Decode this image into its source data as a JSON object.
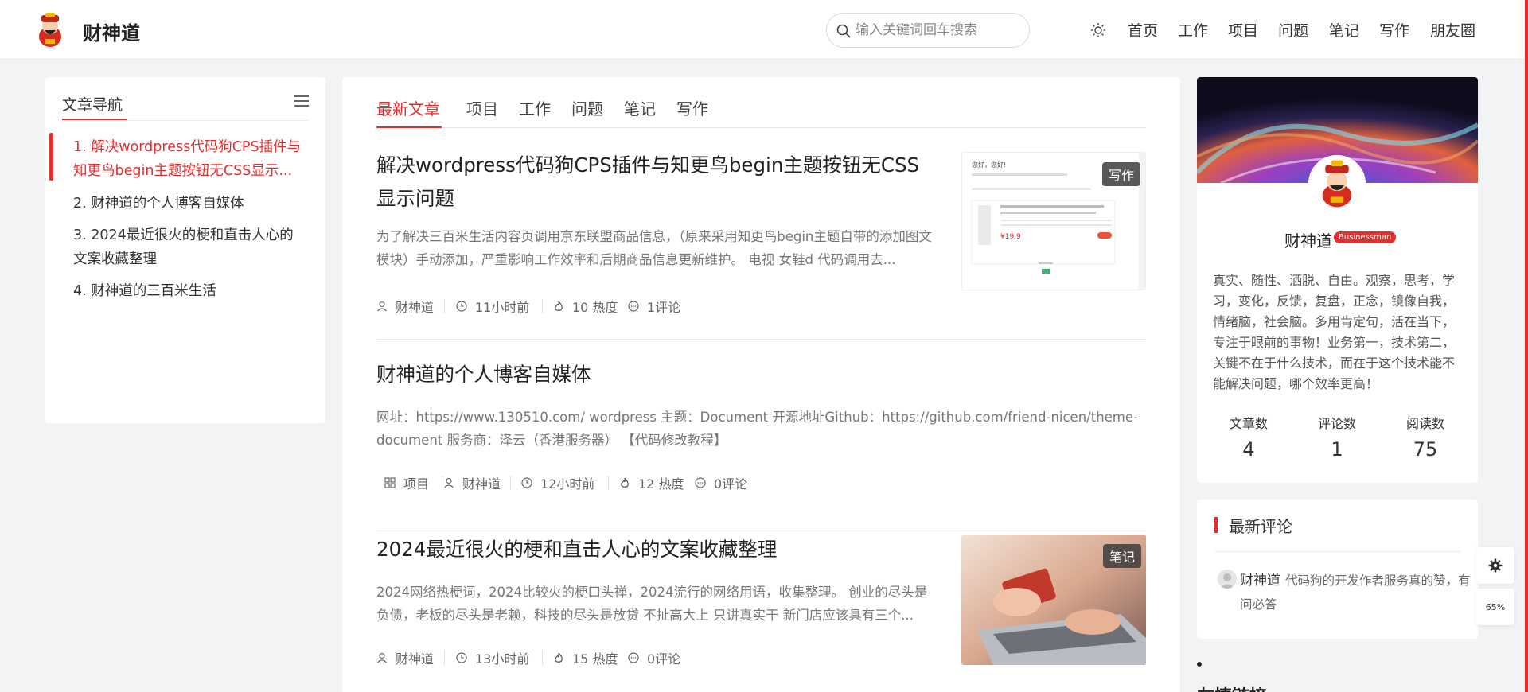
{
  "header": {
    "site_name": "财神道",
    "search_placeholder": "输入关键词回车搜索",
    "nav": [
      "首页",
      "工作",
      "项目",
      "问题",
      "笔记",
      "写作",
      "朋友圈"
    ]
  },
  "toc": {
    "title": "文章导航",
    "items": [
      "1. 解决wordpress代码狗CPS插件与知更鸟begin主题按钮无CSS显示...",
      "2. 财神道的个人博客自媒体",
      "3. 2024最近很火的梗和直击人心的文案收藏整理",
      "4. 财神道的三百米生活"
    ]
  },
  "main": {
    "tabs": [
      "最新文章",
      "项目",
      "工作",
      "问题",
      "笔记",
      "写作"
    ],
    "posts": [
      {
        "title": "解决wordpress代码狗CPS插件与知更鸟begin主题按钮无CSS显示问题",
        "excerpt": "为了解决三百米生活内容页调用京东联盟商品信息，（原来采用知更鸟begin主题自带的添加图文模块）手动添加，严重影响工作效率和后期商品信息更新维护。 电视 女鞋d 代码调用去...",
        "author": "财神道",
        "time": "11小时前",
        "heat": "10 热度",
        "comments": "1评论",
        "badge": "写作"
      },
      {
        "title": "财神道的个人博客自媒体",
        "excerpt": "网址：https://www.130510.com/ wordpress 主题：Document 开源地址Github：https://github.com/friend-nicen/theme-document 服务商：泽云（香港服务器） 【代码修改教程】",
        "category": "项目",
        "author": "财神道",
        "time": "12小时前",
        "heat": "12 热度",
        "comments": "0评论"
      },
      {
        "title": "2024最近很火的梗和直击人心的文案收藏整理",
        "excerpt": "2024网络热梗词，2024比较火的梗口头禅，2024流行的网络用语，收集整理。 创业的尽头是负债，老板的尽头是老赖，科技的尽头是放贷 不扯高大上 只讲真实干 新门店应该具有三个...",
        "author": "财神道",
        "time": "13小时前",
        "heat": "15 热度",
        "comments": "0评论",
        "badge": "笔记"
      }
    ],
    "thumb1_text": {
      "greeting": "您好，您好!",
      "price": "¥19.9"
    }
  },
  "profile": {
    "name": "财神道",
    "badge": "Businessman",
    "bio": "真实、随性、洒脱、自由。观察，思考，学习，变化，反馈，复盘，正念，镜像自我，情绪脑，社会脑。多用肯定句，活在当下，专注于眼前的事物！业务第一，技术第二，关键不在于什么技术，而在于这个技术能不能解决问题，哪个效率更高！",
    "stats": [
      {
        "label": "文章数",
        "value": "4"
      },
      {
        "label": "评论数",
        "value": "1"
      },
      {
        "label": "阅读数",
        "value": "75"
      }
    ]
  },
  "comments": {
    "title": "最新评论",
    "author": "财神道",
    "text": "代码狗的开发作者服务真的赞，有问必答"
  },
  "partial_heading": "友情链接",
  "fab": {
    "progress": "65%"
  },
  "colors": {
    "accent": "#e52e2e",
    "background": "#f2f3f5"
  }
}
